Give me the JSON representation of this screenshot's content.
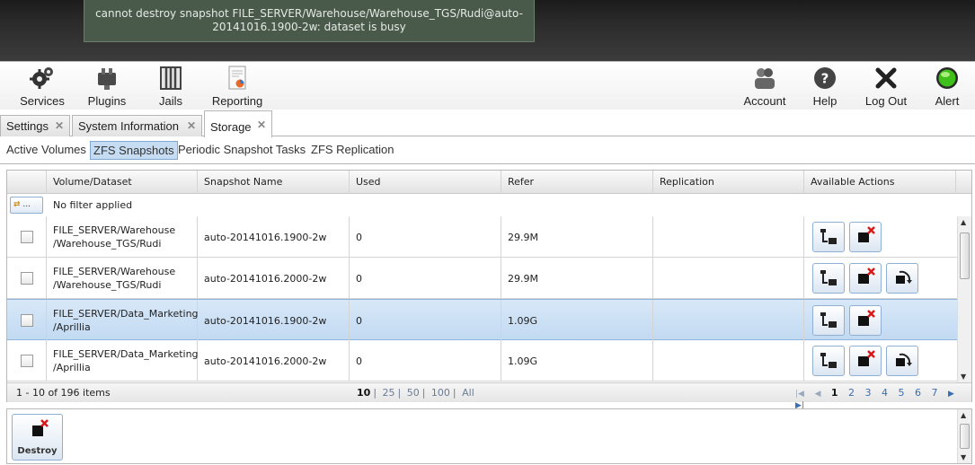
{
  "error": {
    "message": "cannot destroy snapshot FILE_SERVER/Warehouse/Warehouse_TGS/Rudi@auto-20141016.1900-2w: dataset is busy"
  },
  "toolbar": {
    "left": [
      {
        "label": "Services",
        "icon": "services-gear-icon"
      },
      {
        "label": "Plugins",
        "icon": "plugins-icon"
      },
      {
        "label": "Jails",
        "icon": "jails-icon"
      },
      {
        "label": "Reporting",
        "icon": "reporting-icon"
      }
    ],
    "right": [
      {
        "label": "Account",
        "icon": "account-icon"
      },
      {
        "label": "Help",
        "icon": "help-icon"
      },
      {
        "label": "Log Out",
        "icon": "logout-icon"
      },
      {
        "label": "Alert",
        "icon": "alert-icon",
        "status_color": "#3fbf1a"
      }
    ]
  },
  "tabs": [
    {
      "label": "Settings",
      "active": false
    },
    {
      "label": "System Information",
      "active": false
    },
    {
      "label": "Storage",
      "active": true
    }
  ],
  "subtabs": [
    {
      "label": "Active Volumes",
      "active": false
    },
    {
      "label": "ZFS Snapshots",
      "active": true
    },
    {
      "label": "Periodic Snapshot Tasks",
      "active": false
    },
    {
      "label": "ZFS Replication",
      "active": false
    }
  ],
  "grid": {
    "columns": [
      "Volume/Dataset",
      "Snapshot Name",
      "Used",
      "Refer",
      "Replication",
      "Available Actions"
    ],
    "filter_button_label": "...",
    "filter_text": "No filter applied",
    "rows": [
      {
        "dataset_line1": "FILE_SERVER/Warehouse",
        "dataset_line2": "/Warehouse_TGS/Rudi",
        "snapshot": "auto-20141016.1900-2w",
        "used": "0",
        "refer": "29.9M",
        "replication": "",
        "actions": [
          "clone",
          "destroy"
        ],
        "selected": false
      },
      {
        "dataset_line1": "FILE_SERVER/Warehouse",
        "dataset_line2": "/Warehouse_TGS/Rudi",
        "snapshot": "auto-20141016.2000-2w",
        "used": "0",
        "refer": "29.9M",
        "replication": "",
        "actions": [
          "clone",
          "destroy",
          "rollback"
        ],
        "selected": false
      },
      {
        "dataset_line1": "FILE_SERVER/Data_Marketing",
        "dataset_line2": "/Aprillia",
        "snapshot": "auto-20141016.1900-2w",
        "used": "0",
        "refer": "1.09G",
        "replication": "",
        "actions": [
          "clone",
          "destroy"
        ],
        "selected": true
      },
      {
        "dataset_line1": "FILE_SERVER/Data_Marketing",
        "dataset_line2": "/Aprillia",
        "snapshot": "auto-20141016.2000-2w",
        "used": "0",
        "refer": "1.09G",
        "replication": "",
        "actions": [
          "clone",
          "destroy",
          "rollback"
        ],
        "selected": false
      }
    ],
    "footer": {
      "count_text": "1 - 10 of 196 items",
      "page_sizes": [
        "10",
        "25",
        "50",
        "100",
        "All"
      ],
      "current_page_size": "10",
      "pages": [
        "1",
        "2",
        "3",
        "4",
        "5",
        "6",
        "7"
      ],
      "current_page": "1"
    }
  },
  "action_panel": {
    "destroy_label": "Destroy"
  }
}
